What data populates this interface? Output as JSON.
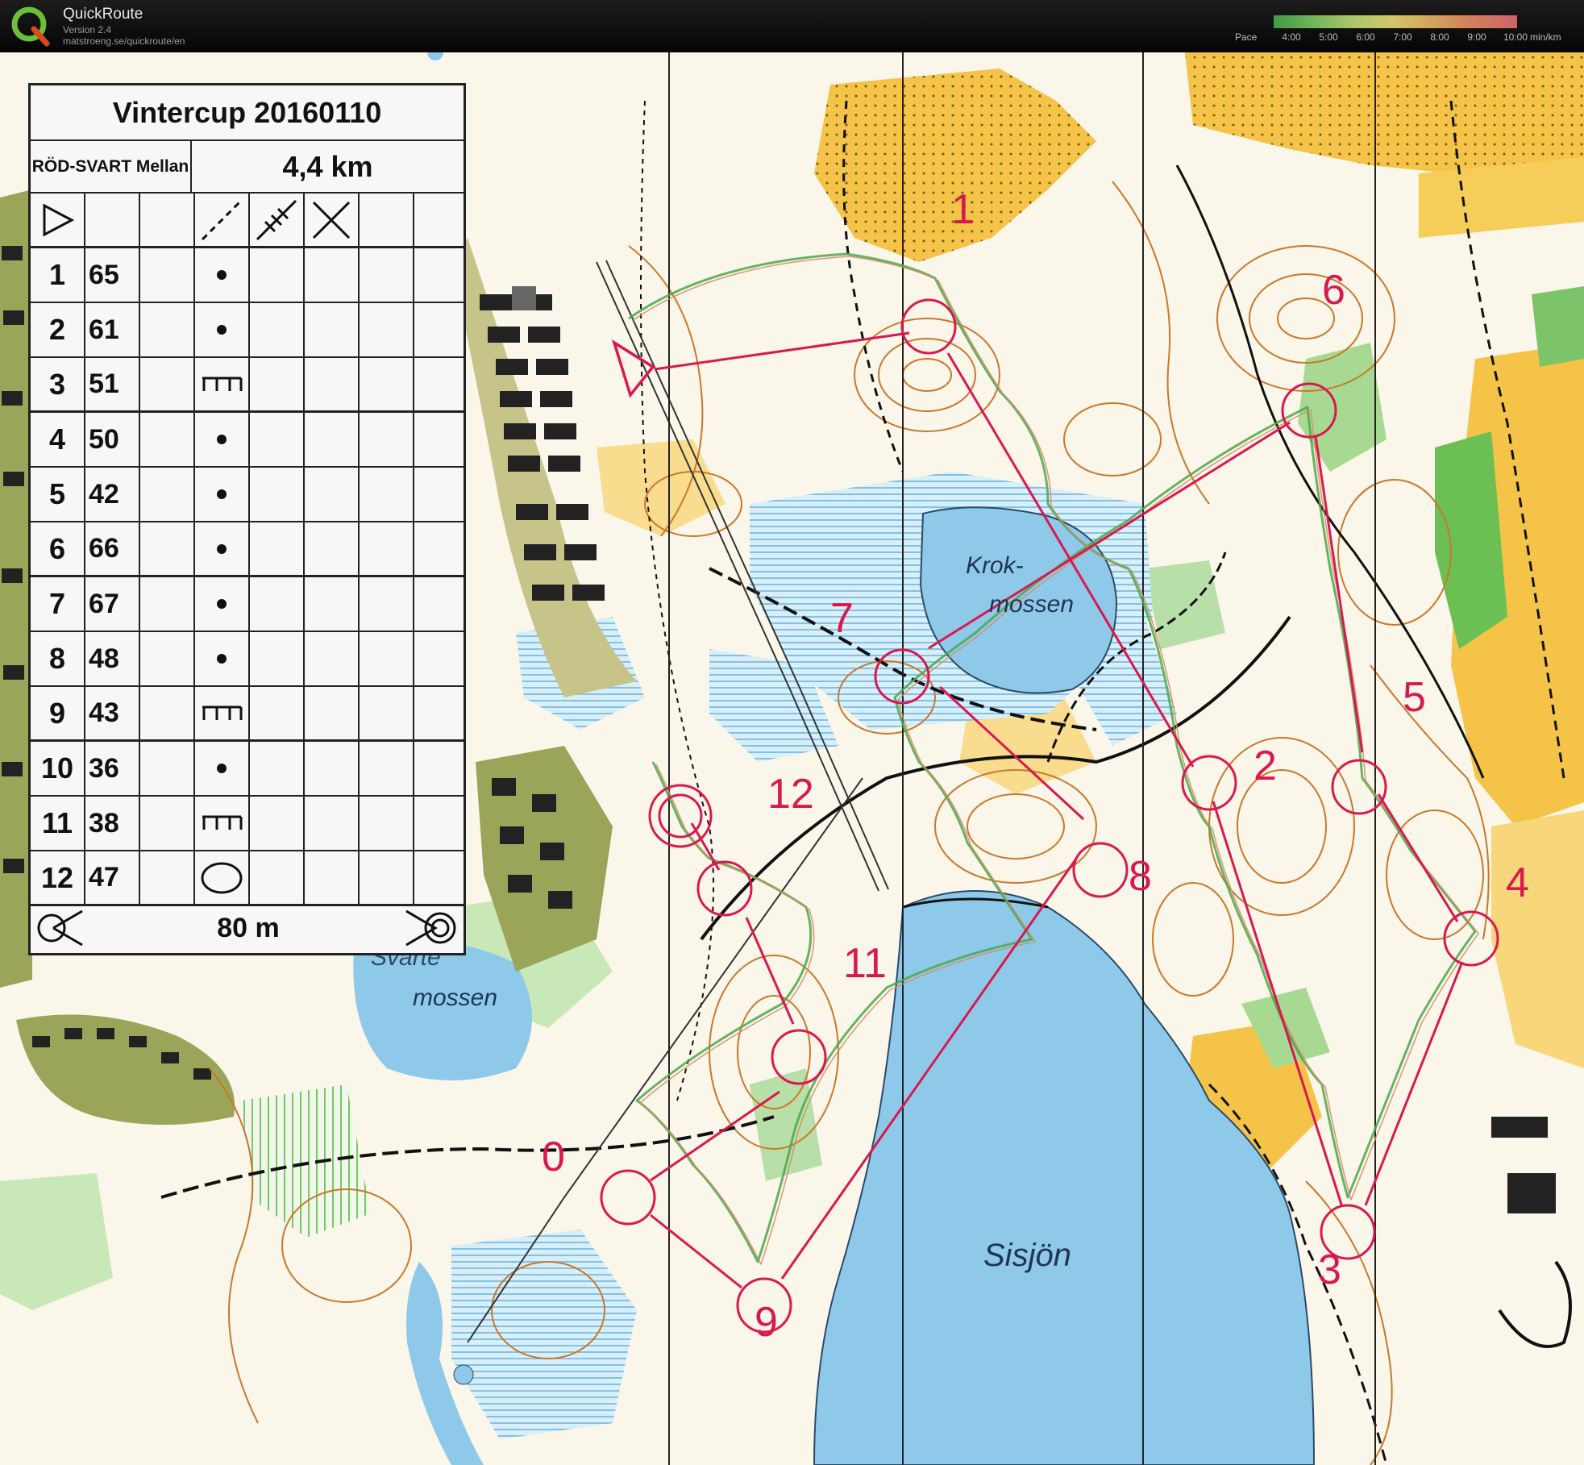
{
  "app": {
    "name": "QuickRoute",
    "version": "Version 2.4",
    "url": "matstroeng.se/quickroute/en"
  },
  "pace_legend": {
    "label": "Pace",
    "ticks": [
      "4:00",
      "5:00",
      "6:00",
      "7:00",
      "8:00",
      "9:00",
      "10:00"
    ],
    "unit": "min/km"
  },
  "control_card": {
    "title": "Vintercup 20160110",
    "class": "RÖD-SVART Mellan",
    "length": "4,4 km",
    "rows": [
      {
        "num": "1",
        "code": "65",
        "symbol": "dot"
      },
      {
        "num": "2",
        "code": "61",
        "symbol": "dot"
      },
      {
        "num": "3",
        "code": "51",
        "symbol": "comb"
      },
      {
        "num": "4",
        "code": "50",
        "symbol": "dot"
      },
      {
        "num": "5",
        "code": "42",
        "symbol": "dot"
      },
      {
        "num": "6",
        "code": "66",
        "symbol": "dot"
      },
      {
        "num": "7",
        "code": "67",
        "symbol": "dot"
      },
      {
        "num": "8",
        "code": "48",
        "symbol": "dot"
      },
      {
        "num": "9",
        "code": "43",
        "symbol": "comb"
      },
      {
        "num": "10",
        "code": "36",
        "symbol": "dot"
      },
      {
        "num": "11",
        "code": "38",
        "symbol": "comb"
      },
      {
        "num": "12",
        "code": "47",
        "symbol": "oval"
      }
    ],
    "finish_distance": "80 m"
  },
  "map": {
    "labels": {
      "lake_krok_1": "Krok-",
      "lake_krok_2": "mossen",
      "lake_svarte_1": "Svarte",
      "lake_svarte_2": "mossen",
      "lake_sisjon": "Sisjön"
    },
    "control_numbers": [
      "1",
      "2",
      "3",
      "4",
      "5",
      "6",
      "7",
      "8",
      "9",
      "0",
      "11",
      "12"
    ],
    "colors": {
      "course": "#d9184f",
      "water": "#8fc9ea",
      "open_land": "#f3c53d",
      "forest_green": "#b8dfa8",
      "contour": "#c9782a",
      "building": "#222222"
    }
  }
}
